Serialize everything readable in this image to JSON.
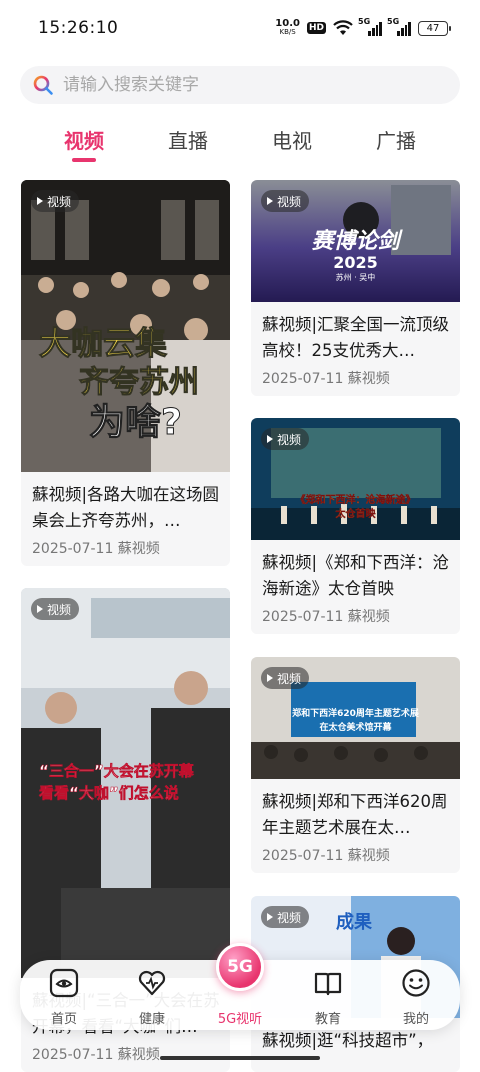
{
  "status": {
    "time": "15:26:10",
    "net_speed_value": "10.0",
    "net_speed_unit": "KB/S",
    "hd": "HD",
    "sig1_tag": "5G",
    "sig2_tag": "5G",
    "battery": "47"
  },
  "search": {
    "placeholder": "请输入搜索关键字"
  },
  "tabs": [
    {
      "label": "视频",
      "active": true
    },
    {
      "label": "直播",
      "active": false
    },
    {
      "label": "电视",
      "active": false
    },
    {
      "label": "广播",
      "active": false
    }
  ],
  "feed": {
    "badge_label": "视频",
    "left": [
      {
        "title": "蘇视频|各路大咖在这场圆桌会上齐夸苏州，…",
        "meta": "2025-07-11 蘇视频",
        "overlay": [
          "大咖云集",
          "齐夸苏州",
          "为啥?"
        ]
      },
      {
        "title": "蘇视频|“三合一”大会在苏开幕，看看“大咖”们…",
        "meta": "2025-07-11 蘇视频",
        "overlay": [
          "“三合一”大会在苏开幕",
          "看看“大咖”们怎么说"
        ]
      }
    ],
    "right": [
      {
        "title": "蘇视频|汇聚全国一流顶级高校！25支优秀大…",
        "meta": "2025-07-11 蘇视频",
        "overlay": [
          "赛博论剑",
          "2025",
          "苏州 · 吴中"
        ]
      },
      {
        "title": "蘇视频|《郑和下西洋：沧海新途》太仓首映",
        "meta": "2025-07-11 蘇视频",
        "overlay": [
          "《郑和下西洋：沧海新途》",
          "太仓首映"
        ]
      },
      {
        "title": "蘇视频|郑和下西洋620周年主题艺术展在太…",
        "meta": "2025-07-11 蘇视频",
        "overlay": [
          "郑和下西洋620周年主题艺术展",
          "在太仓美术馆开幕"
        ]
      },
      {
        "title": "蘇视频|逛“科技超市”，",
        "meta": "",
        "overlay": [
          "成果"
        ]
      }
    ]
  },
  "nav": {
    "home": "首页",
    "health": "健康",
    "center": "5G视听",
    "center_badge": "5G",
    "education": "教育",
    "mine": "我的"
  },
  "colors": {
    "accent": "#e8356e"
  }
}
